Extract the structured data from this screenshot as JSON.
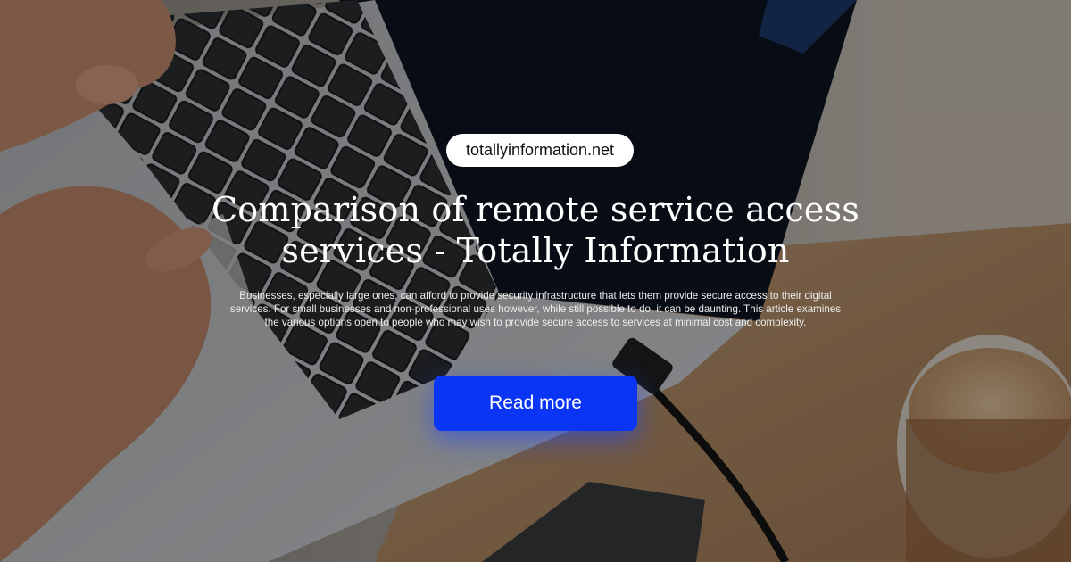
{
  "site": {
    "domain": "totallyinformation.net"
  },
  "article": {
    "title": "Comparison of remote service access services - Totally Information",
    "description": "Businesses, especially large ones, can afford to provide security infrastructure that lets them provide secure access to their digital services. For small businesses and non-professional uses however, while still possible to do, it can be daunting. This article examines the various options open to people who may wish to provide secure access to services at minimal cost and complexity."
  },
  "cta": {
    "label": "Read more",
    "color": "#0a35f5"
  },
  "background": {
    "subject": "hands typing on laptop beside coffee cup"
  }
}
